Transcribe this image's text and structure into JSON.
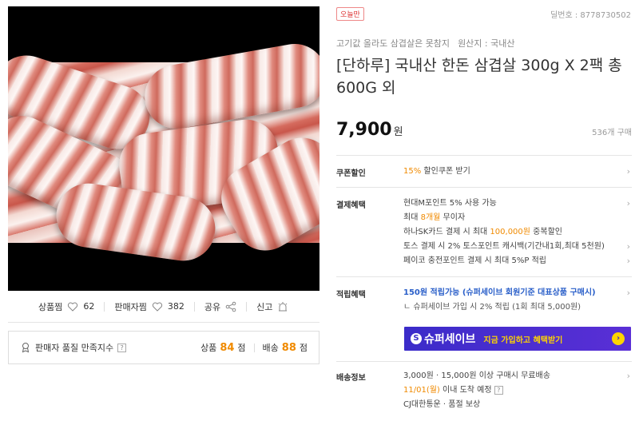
{
  "left": {
    "actions": [
      {
        "label": "상품찜",
        "icon": "heart-icon",
        "count": "62"
      },
      {
        "label": "판매자찜",
        "icon": "heart-icon",
        "count": "382"
      },
      {
        "label": "공유",
        "icon": "share-icon"
      },
      {
        "label": "신고",
        "icon": "alarm-icon"
      }
    ],
    "rating": {
      "label": "판매자 품질 만족지수",
      "help": "?",
      "product_label": "상품",
      "product_score": "84",
      "score_unit": "점",
      "delivery_label": "배송",
      "delivery_score": "88",
      "delivery_unit": "점"
    }
  },
  "right": {
    "badge": "오늘만",
    "product_number": "딜번호 : 8778730502",
    "subline": [
      "고기값 올라도 삼겹살은 못참지",
      "원산지 : 국내산"
    ],
    "title": "[단하루] 국내산 한돈 삼겹살 300g X 2팩 총 600G 외",
    "price": "7,900",
    "price_unit": "원",
    "sold": "536개 구매",
    "coupon": {
      "label": "쿠폰할인",
      "rate": "15%",
      "text": "할인쿠폰 받기"
    },
    "payment": {
      "label": "결제혜택",
      "lines": [
        {
          "a": "현대M포인트 5% 사용 가능",
          "b": "",
          "c": ""
        },
        {
          "a": "최대 ",
          "b": "8개월",
          "c": " 무이자"
        },
        {
          "a": "하나SK카드 결제 시 최대 ",
          "b": "100,000원",
          "c": " 중복할인"
        },
        {
          "a": "토스 결제 시 2% 토스포인트 캐시백(기간내1회,최대 5천원)",
          "b": "",
          "c": ""
        },
        {
          "a": "페이코 충전포인트 결제 시 최대 5%P 적립",
          "b": "",
          "c": ""
        }
      ]
    },
    "points": {
      "label": "적립혜택",
      "line1": "150원 적립가능 (슈퍼세이브 회원기준 대표상품 구매시)",
      "line2": "ㄴ 슈퍼세이브 가입 시 2% 적립 (1회 최대 5,000원)",
      "banner_logo": "슈퍼세이브",
      "banner_cta": "지금 가입하고 혜택받기"
    },
    "delivery": {
      "label": "배송정보",
      "line1": "3,000원 · 15,000원 이상 구매시 무료배송",
      "date": "11/01(월)",
      "line2": " 이내 도착 예정",
      "line3": "CJ대한통운 · 품절 보상"
    }
  }
}
